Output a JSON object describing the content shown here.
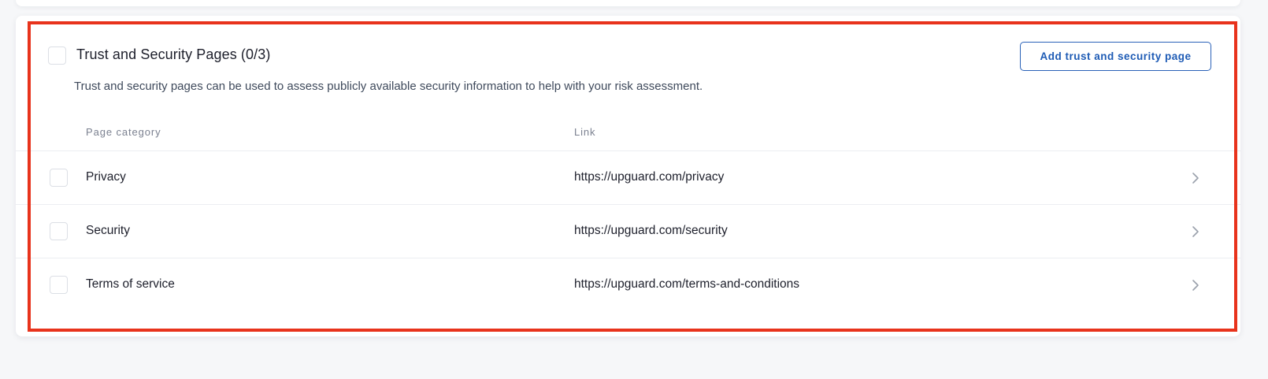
{
  "section": {
    "title": "Trust and Security Pages (0/3)",
    "description": "Trust and security pages can be used to assess publicly available security information to help with your risk assessment.",
    "add_button_label": "Add trust and security page"
  },
  "table": {
    "headers": {
      "category": "Page category",
      "link": "Link"
    },
    "rows": [
      {
        "category": "Privacy",
        "link": "https://upguard.com/privacy"
      },
      {
        "category": "Security",
        "link": "https://upguard.com/security"
      },
      {
        "category": "Terms of service",
        "link": "https://upguard.com/terms-and-conditions"
      }
    ]
  },
  "colors": {
    "accent": "#1e5bb5",
    "highlight": "#e8331c",
    "background": "#f6f7f9"
  },
  "icons": {
    "row_action": "chevron-right-icon"
  }
}
